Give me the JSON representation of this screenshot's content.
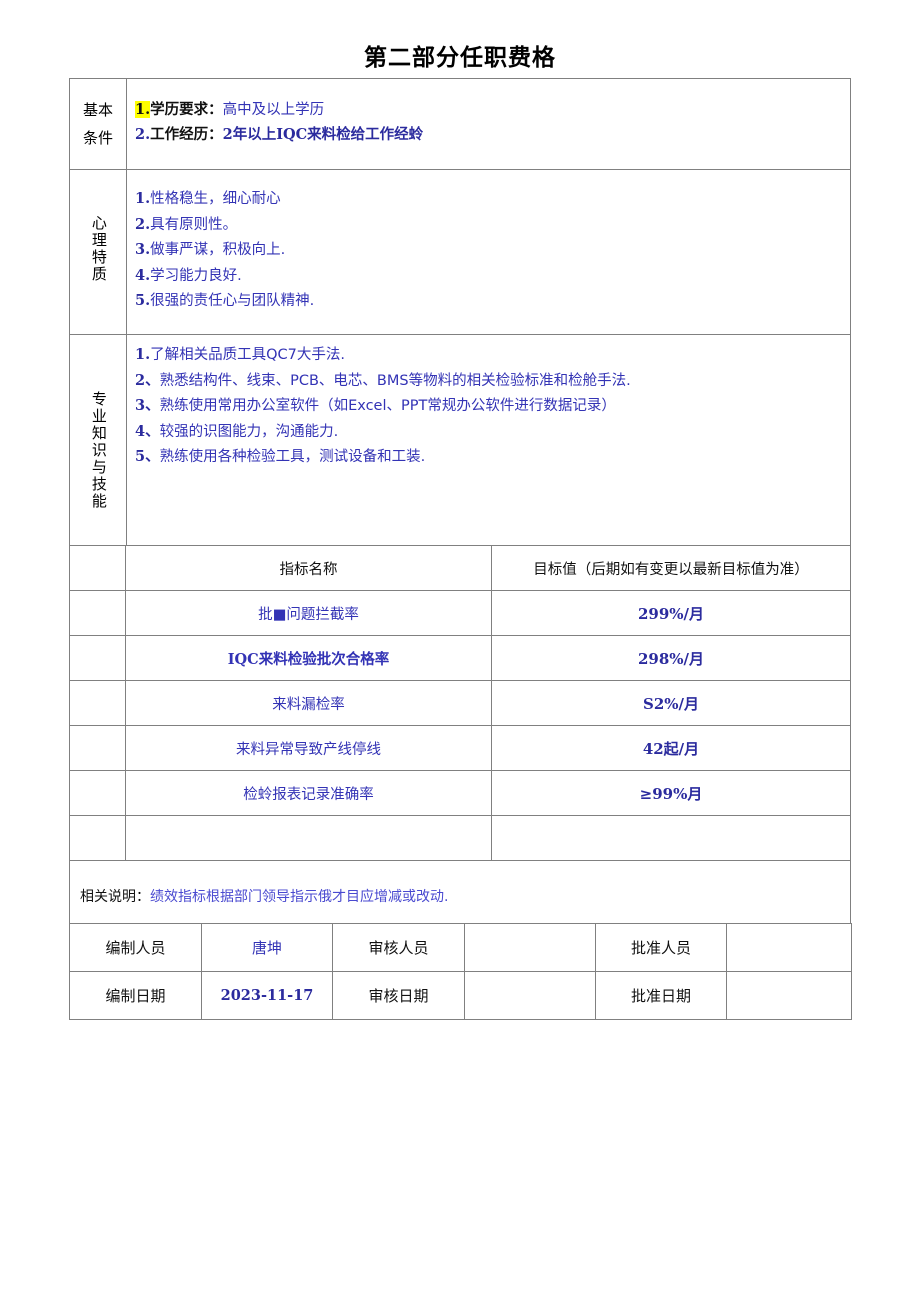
{
  "document": {
    "title": "第二部分任职费格"
  },
  "qualification_table": {
    "rows": [
      {
        "label": "基本\n条件",
        "label_lines": [
          "基本",
          "条件"
        ],
        "label_style": "stacked",
        "items": [
          {
            "num": "1.",
            "num_highlight": true,
            "lead": "学历要求：",
            "text": "高中及以上学历"
          },
          {
            "num": "2.",
            "num_highlight": false,
            "lead": "工作经历：",
            "text": "2年以上IQC来料检给工作经蛉"
          }
        ]
      },
      {
        "label": "心理特质",
        "label_lines": [
          "心",
          "理",
          "特",
          "质"
        ],
        "label_style": "vertical",
        "items": [
          {
            "num": "1.",
            "text": "性格稳生，细心耐心"
          },
          {
            "num": "2.",
            "text": "具有原则性。"
          },
          {
            "num": "3.",
            "text": "做事严谋，积极向上."
          },
          {
            "num": "4.",
            "text": "学习能力良好."
          },
          {
            "num": "5.",
            "text": "很强的责任心与团队精神."
          }
        ]
      },
      {
        "label": "专业知识与技能",
        "label_lines": [
          "专",
          "业",
          "知",
          "识",
          "与",
          "技",
          "能"
        ],
        "label_style": "vertical",
        "items": [
          {
            "num": "1.",
            "text": "了解相关品质工具QC7大手法."
          },
          {
            "num": "2、",
            "text": "熟悉结构件、线束、PCB、电芯、BMS等物料的相关检验标准和检舱手法."
          },
          {
            "num": "3、",
            "text": "熟练使用常用办公室软件（如Excel、PPT常规办公软件进行数据记录）"
          },
          {
            "num": "4、",
            "text": "较强的识图能力，沟通能力."
          },
          {
            "num": "5、",
            "text": "熟练使用各种检验工具，测试设备和工装."
          }
        ]
      }
    ]
  },
  "kpi_table": {
    "headers": {
      "name": "指标名称",
      "value": "目标值（后期如有变更以最新目标值为准）"
    },
    "rows": [
      {
        "name": "批■问题拦截率",
        "bold": false,
        "value": "299%/月"
      },
      {
        "name": "IQC来料检验批次合格率",
        "bold": true,
        "value": "298%/月"
      },
      {
        "name": "来料漏检率",
        "bold": false,
        "value": "S2%/月"
      },
      {
        "name": "来料异常导致产线停线",
        "bold": false,
        "value": "42起/月"
      },
      {
        "name": "检蛉报表记录准确率",
        "bold": false,
        "value": "≥99%月"
      },
      {
        "name": "",
        "bold": false,
        "value": ""
      }
    ],
    "note": {
      "label": "相关说明：",
      "text": "绩效指标根据部门领导指示俄才目应增减或改动."
    }
  },
  "signature_table": {
    "rows": [
      {
        "cells": [
          {
            "text": "编制人员",
            "kind": "label"
          },
          {
            "text": "唐坤",
            "kind": "value"
          },
          {
            "text": "审核人员",
            "kind": "label"
          },
          {
            "text": "",
            "kind": "value"
          },
          {
            "text": "批准人员",
            "kind": "label"
          },
          {
            "text": "",
            "kind": "value"
          }
        ]
      },
      {
        "cells": [
          {
            "text": "编制日期",
            "kind": "label"
          },
          {
            "text": "2023-11-17",
            "kind": "value-serif"
          },
          {
            "text": "审核日期",
            "kind": "label"
          },
          {
            "text": "",
            "kind": "value"
          },
          {
            "text": "批准日期",
            "kind": "label"
          },
          {
            "text": "",
            "kind": "value"
          }
        ]
      }
    ]
  },
  "colors": {
    "body_text": "#3333b5",
    "heading_text": "#000000",
    "highlight": "#ffff00",
    "border": "#808080"
  }
}
